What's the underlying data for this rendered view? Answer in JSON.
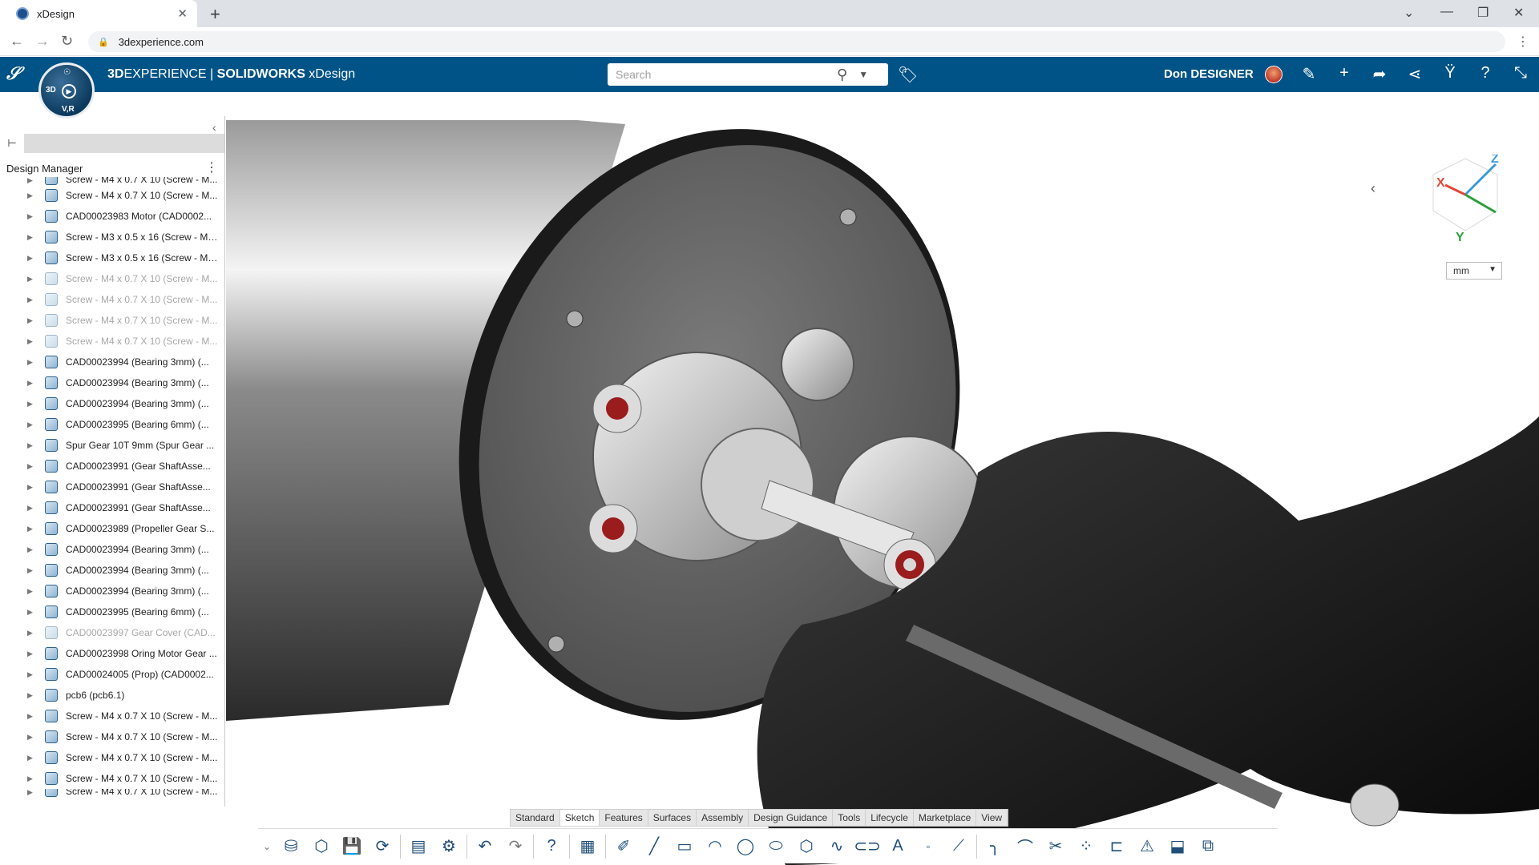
{
  "browser": {
    "tab_title": "xDesign",
    "tab_close": "✕",
    "new_tab": "+",
    "url": "3dexperience.com",
    "win_min": "—",
    "win_restore": "❐",
    "win_close": "✕",
    "win_chevron": "⌄"
  },
  "app": {
    "brand_strong1": "3D",
    "brand_strong2": "EXPERIENCE",
    "brand_sep": " | ",
    "brand_strong3": "SOLIDWORKS",
    "brand_app": " xDesign",
    "search_placeholder": "Search",
    "user_name": "Don DESIGNER",
    "compass_3d": "3D",
    "compass_vr": "V,R",
    "accent_color": "#005386"
  },
  "design_manager": {
    "title": "Design Manager",
    "rows": [
      {
        "label": "Screw - M4 x 0.7 X 10 (Screw - M...",
        "dim": false,
        "partial": true
      },
      {
        "label": "Screw - M4 x 0.7 X 10 (Screw - M...",
        "dim": false
      },
      {
        "label": "CAD00023983 Motor (CAD0002...",
        "dim": false
      },
      {
        "label": "Screw - M3 x 0.5 x 16 (Screw - M3...",
        "dim": false
      },
      {
        "label": "Screw - M3 x 0.5 x 16 (Screw - M3...",
        "dim": false
      },
      {
        "label": "Screw - M4 x 0.7 X 10 (Screw - M...",
        "dim": true
      },
      {
        "label": "Screw - M4 x 0.7 X 10 (Screw - M...",
        "dim": true
      },
      {
        "label": "Screw - M4 x 0.7 X 10 (Screw - M...",
        "dim": true
      },
      {
        "label": "Screw - M4 x 0.7 X 10 (Screw - M...",
        "dim": true
      },
      {
        "label": "CAD00023994 (Bearing 3mm) (...",
        "dim": false
      },
      {
        "label": "CAD00023994 (Bearing 3mm) (...",
        "dim": false
      },
      {
        "label": "CAD00023994 (Bearing 3mm) (...",
        "dim": false
      },
      {
        "label": "CAD00023995 (Bearing 6mm) (...",
        "dim": false
      },
      {
        "label": "Spur Gear 10T 9mm (Spur Gear ...",
        "dim": false
      },
      {
        "label": "CAD00023991 (Gear ShaftAsse...",
        "dim": false
      },
      {
        "label": "CAD00023991 (Gear ShaftAsse...",
        "dim": false
      },
      {
        "label": "CAD00023991 (Gear ShaftAsse...",
        "dim": false
      },
      {
        "label": "CAD00023989 (Propeller Gear S...",
        "dim": false
      },
      {
        "label": "CAD00023994 (Bearing 3mm) (...",
        "dim": false
      },
      {
        "label": "CAD00023994 (Bearing 3mm) (...",
        "dim": false
      },
      {
        "label": "CAD00023994 (Bearing 3mm) (...",
        "dim": false
      },
      {
        "label": "CAD00023995 (Bearing 6mm) (...",
        "dim": false
      },
      {
        "label": "CAD00023997 Gear Cover (CAD...",
        "dim": true
      },
      {
        "label": "CAD00023998 Oring Motor Gear ...",
        "dim": false
      },
      {
        "label": "CAD00024005 (Prop) (CAD0002...",
        "dim": false
      },
      {
        "label": "pcb6 (pcb6.1)",
        "dim": false
      },
      {
        "label": "Screw - M4 x 0.7 X 10 (Screw - M...",
        "dim": false
      },
      {
        "label": "Screw - M4 x 0.7 X 10 (Screw - M...",
        "dim": false
      },
      {
        "label": "Screw - M4 x 0.7 X 10 (Screw - M...",
        "dim": false
      },
      {
        "label": "Screw - M4 x 0.7 X 10 (Screw - M...",
        "dim": false
      },
      {
        "label": "Screw - M4 x 0.7 X 10 (Screw - M...",
        "dim": false,
        "partial": true
      }
    ]
  },
  "viewport": {
    "units": "mm",
    "triad": {
      "x": "X",
      "y": "Y",
      "z": "Z"
    }
  },
  "command_manager": {
    "tabs": [
      "Standard",
      "Sketch",
      "Features",
      "Surfaces",
      "Assembly",
      "Design Guidance",
      "Tools",
      "Lifecycle",
      "Marketplace",
      "View"
    ],
    "active_tab": "Sketch"
  }
}
